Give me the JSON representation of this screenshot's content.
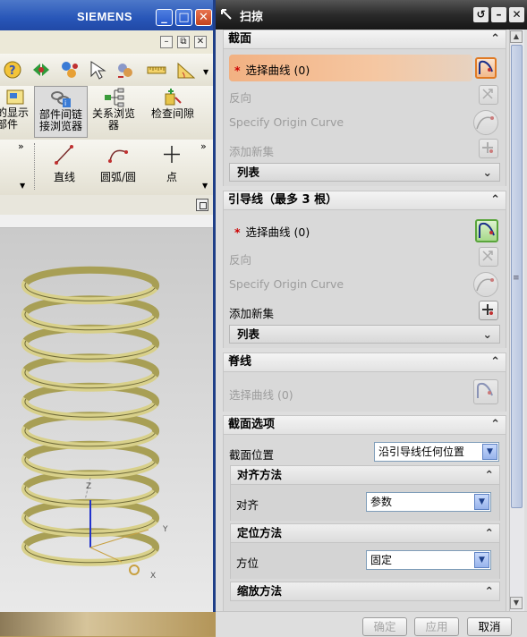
{
  "nx_window": {
    "brand": "SIEMENS",
    "window_buttons": {
      "minimize": "_",
      "restore": "□",
      "close": "✕"
    },
    "mdi_buttons": {
      "minimize": "–",
      "restore": "⧉",
      "close": "✕"
    },
    "toolbar2": {
      "left_partial_line1": "的显示",
      "left_partial_line2": "部件",
      "assembly_nav_line1": "部件间链",
      "assembly_nav_line2": "接浏览器",
      "relation_nav_line1": "关系浏览",
      "relation_nav_line2": "器",
      "check_clearance": "检查间隙"
    },
    "toolbar3": {
      "line": "直线",
      "arc": "圆弧/圆",
      "point": "点"
    },
    "overflow": "»",
    "model": {
      "type": "helical spring",
      "coil_color": "#d8d08a"
    }
  },
  "dialog": {
    "title": "扫掠",
    "title_buttons": {
      "reset": "↺",
      "minimize": "–",
      "close": "✕"
    },
    "section_curves": {
      "header": "截面",
      "select_curve": "选择曲线 (0)",
      "reverse": "反向",
      "specify_origin": "Specify Origin Curve",
      "add_new": "添加新集",
      "list": "列表"
    },
    "guide_curves": {
      "header": "引导线（最多 3 根）",
      "select_curve": "选择曲线 (0)",
      "reverse": "反向",
      "specify_origin": "Specify Origin Curve",
      "add_new": "添加新集",
      "list": "列表"
    },
    "spine": {
      "header": "脊线",
      "select_curve": "选择曲线 (0)"
    },
    "section_options": {
      "header": "截面选项",
      "position_label": "截面位置",
      "position_value": "沿引导线任何位置",
      "alignment": {
        "header": "对齐方法",
        "label": "对齐",
        "value": "参数"
      },
      "orientation": {
        "header": "定位方法",
        "label": "方位",
        "value": "固定"
      },
      "scaling": {
        "header": "缩放方法"
      }
    },
    "footer": {
      "ok": "确定",
      "apply": "应用",
      "cancel": "取消"
    },
    "colors": {
      "highlight": "#f2b182",
      "active_icon": "#5aa53c",
      "required": "#cc0000"
    }
  }
}
